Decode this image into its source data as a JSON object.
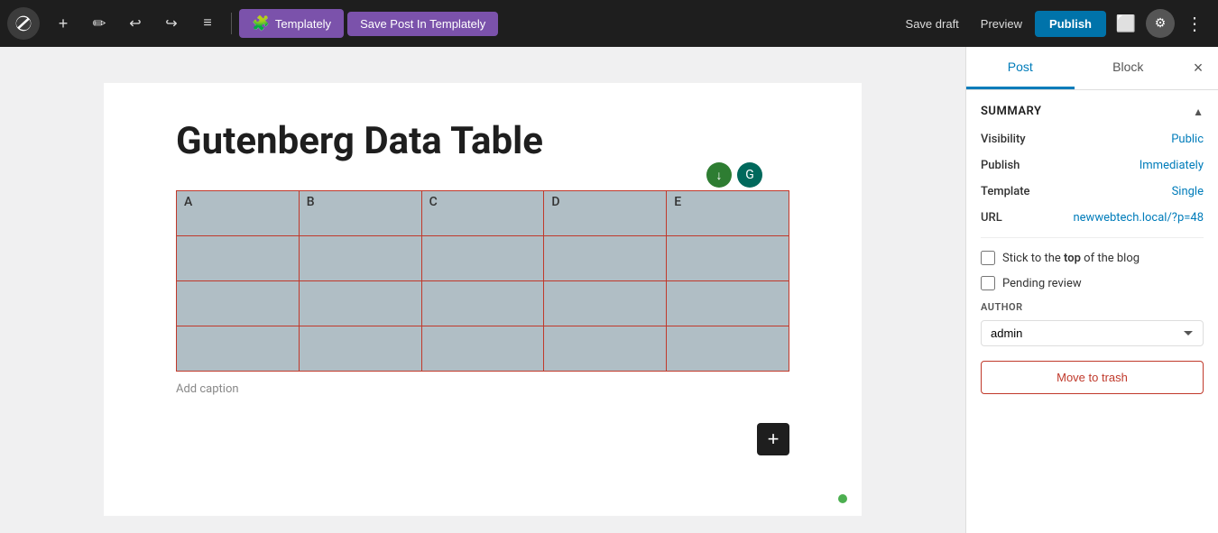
{
  "toolbar": {
    "wp_logo_title": "WordPress",
    "add_label": "+",
    "undo_icon": "↩",
    "redo_icon": "↪",
    "list_icon": "≡",
    "templately_label": "Templately",
    "save_templately_label": "Save Post In Templately",
    "save_draft_label": "Save draft",
    "preview_label": "Preview",
    "publish_label": "Publish"
  },
  "editor": {
    "post_title": "Gutenberg Data Table",
    "table": {
      "headers": [
        "A",
        "B",
        "C",
        "D",
        "E"
      ],
      "rows": 3
    },
    "add_caption_placeholder": "Add caption",
    "add_block_icon": "+"
  },
  "right_panel": {
    "tab_post": "Post",
    "tab_block": "Block",
    "close_icon": "×",
    "summary_title": "Summary",
    "visibility_label": "Visibility",
    "visibility_value": "Public",
    "publish_label": "Publish",
    "publish_value": "Immediately",
    "template_label": "Template",
    "template_value": "Single",
    "url_label": "URL",
    "url_value": "newwebtech.local/?p=48",
    "stick_to_top_label": "Stick to the ",
    "stick_to_top_bold": "top",
    "stick_to_top_suffix": " of the blog",
    "pending_review_label": "Pending review",
    "author_section_label": "AUTHOR",
    "author_value": "admin",
    "author_options": [
      "admin"
    ],
    "move_to_trash_label": "Move to trash"
  }
}
